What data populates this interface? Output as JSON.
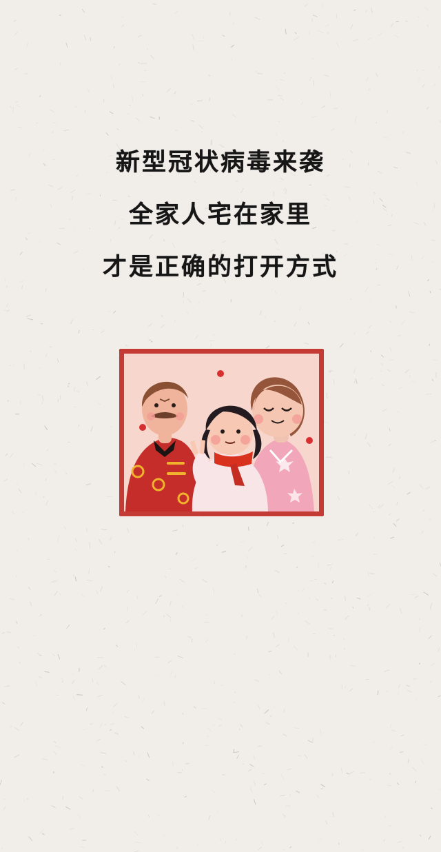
{
  "poem": {
    "lines": [
      "新型冠状病毒来袭",
      "全家人宅在家里",
      "才是正确的打开方式"
    ]
  },
  "illustration": {
    "subject": "family-portrait",
    "frame_color": "#c33b34",
    "background_color": "#f8d7cf",
    "accent_color": "#d72f2f"
  },
  "page": {
    "background_color": "#f1eeea"
  }
}
